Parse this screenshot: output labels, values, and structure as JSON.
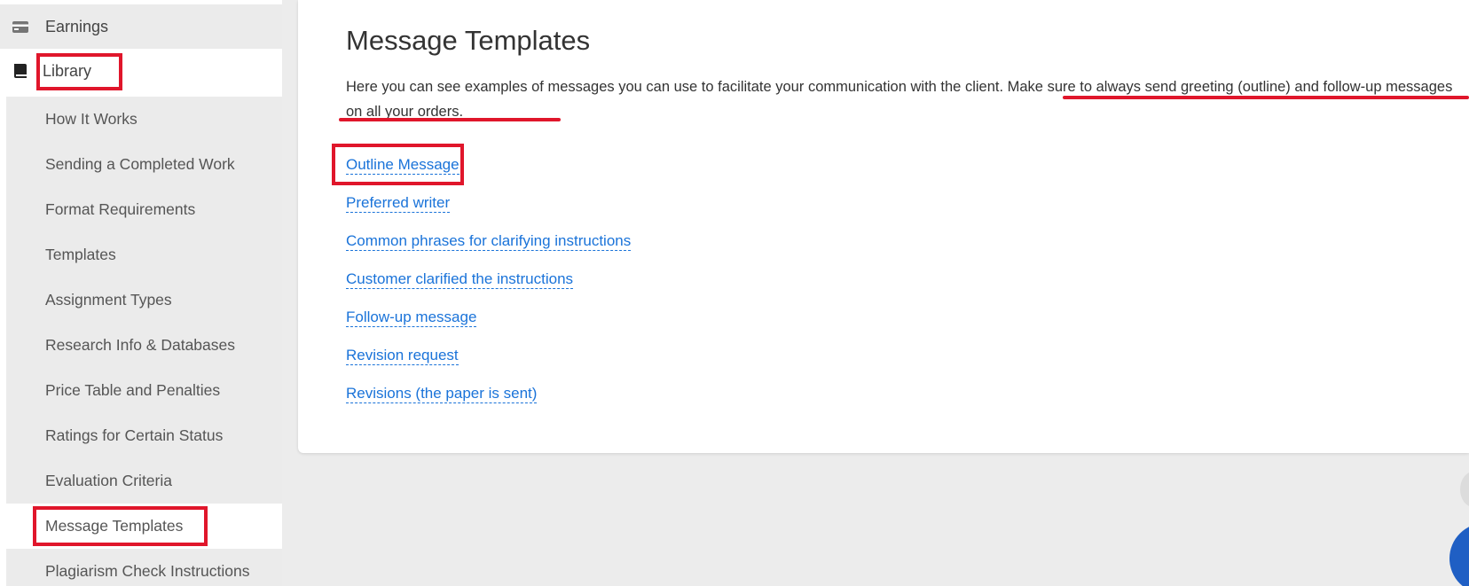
{
  "sidebar": {
    "earnings_label": "Earnings",
    "library_label": "Library",
    "items": [
      {
        "label": "How It Works"
      },
      {
        "label": "Sending a Completed Work"
      },
      {
        "label": "Format Requirements"
      },
      {
        "label": "Templates"
      },
      {
        "label": "Assignment Types"
      },
      {
        "label": "Research Info & Databases"
      },
      {
        "label": "Price Table and Penalties"
      },
      {
        "label": "Ratings for Certain Status"
      },
      {
        "label": "Evaluation Criteria"
      },
      {
        "label": "Message Templates"
      },
      {
        "label": "Plagiarism Check Instructions"
      }
    ],
    "active_item": "Message Templates",
    "icons": {
      "earnings": "card-icon",
      "library": "book-icon"
    }
  },
  "main": {
    "title": "Message Templates",
    "intro_part1": "Here you can see examples of messages you can use to facilitate your communication with the client. ",
    "intro_part2": "Make sure to always send greeting (outline) and follow-up messages on all your orders.",
    "links": [
      {
        "label": "Outline Message"
      },
      {
        "label": "Preferred writer"
      },
      {
        "label": "Common phrases for clarifying instructions"
      },
      {
        "label": "Customer clarified the instructions"
      },
      {
        "label": "Follow-up message"
      },
      {
        "label": "Revision request"
      },
      {
        "label": "Revisions (the paper is sent)"
      }
    ]
  },
  "colors": {
    "link": "#1a73d9",
    "highlight_red": "#e0162b",
    "sidebar_bg": "#ebebeb",
    "page_bg": "#ececec",
    "fab": "#1f5fc4"
  }
}
